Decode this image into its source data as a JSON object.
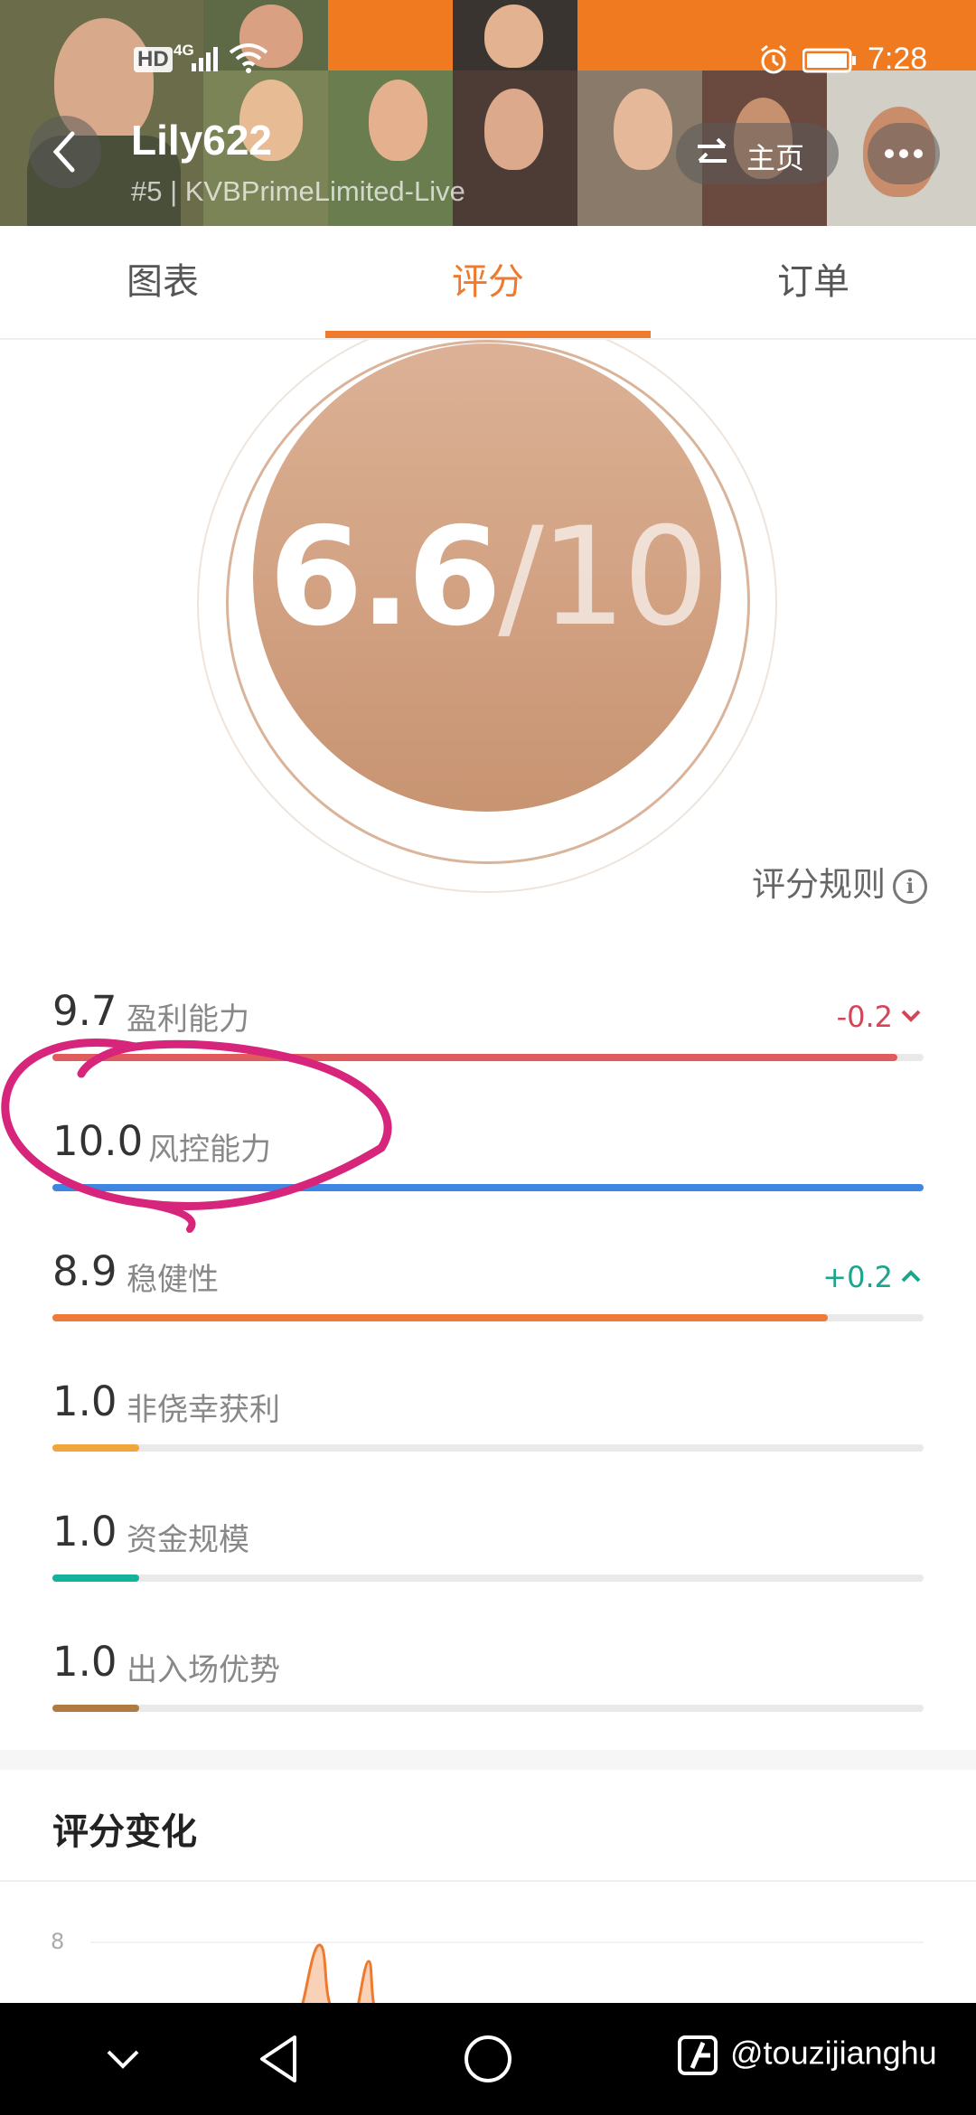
{
  "status_bar": {
    "hd": "HD",
    "network": "4G",
    "time": "7:28"
  },
  "header": {
    "title": "Lily622",
    "subtitle": "#5 | KVBPrimeLimited-Live",
    "home_label": "主页"
  },
  "tabs": [
    {
      "label": "图表"
    },
    {
      "label": "评分"
    },
    {
      "label": "订单"
    }
  ],
  "score": {
    "value": "6.6",
    "denominator": "/10",
    "rules_label": "评分规则"
  },
  "metrics": [
    {
      "value": "9.7",
      "label": "盈利能力",
      "fraction": 0.97,
      "color": "#e05c5c",
      "change": "-0.2",
      "change_dir": "down",
      "change_color": "#d6445a"
    },
    {
      "value": "10.0",
      "label": "风控能力",
      "fraction": 1.0,
      "color": "#3f86e2",
      "change": "",
      "change_dir": "",
      "change_color": ""
    },
    {
      "value": "8.9",
      "label": "稳健性",
      "fraction": 0.89,
      "color": "#ef7a3a",
      "change": "+0.2",
      "change_dir": "up",
      "change_color": "#1aa58c"
    },
    {
      "value": "1.0",
      "label": "非侥幸获利",
      "fraction": 0.1,
      "color": "#f0a63a",
      "change": "",
      "change_dir": "",
      "change_color": ""
    },
    {
      "value": "1.0",
      "label": "资金规模",
      "fraction": 0.1,
      "color": "#13b29a",
      "change": "",
      "change_dir": "",
      "change_color": ""
    },
    {
      "value": "1.0",
      "label": "出入场优势",
      "fraction": 0.1,
      "color": "#b07a43",
      "change": "",
      "change_dir": "",
      "change_color": ""
    }
  ],
  "score_change": {
    "title": "评分变化",
    "y_tick": "8"
  },
  "watermark": "@touzijianghu",
  "colors": {
    "accent": "#ef7a2e",
    "annotation": "#d6257a"
  }
}
